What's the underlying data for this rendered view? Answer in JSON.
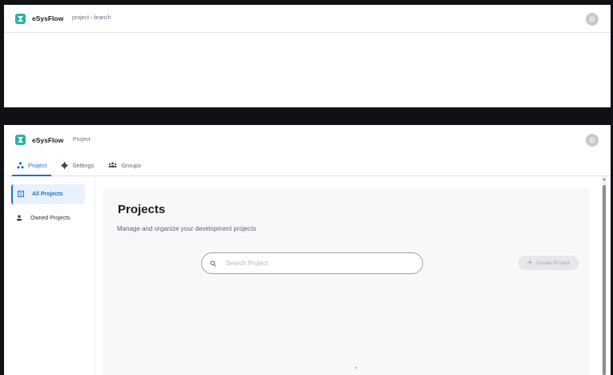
{
  "top_window": {
    "brand": "eSysFlow",
    "breadcrumb": "project › branch",
    "avatar_initial": "D"
  },
  "main_window": {
    "brand": "eSysFlow",
    "context_label": "Project",
    "avatar_initial": "D",
    "tabs": [
      {
        "label": "Project",
        "icon": "project-icon",
        "active": true
      },
      {
        "label": "Settings",
        "icon": "gear-icon",
        "active": false
      },
      {
        "label": "Groups",
        "icon": "groups-icon",
        "active": false
      }
    ],
    "sidebar": {
      "items": [
        {
          "label": "All Projects",
          "icon": "list-icon",
          "active": true
        },
        {
          "label": "Owned Projects",
          "icon": "user-icon",
          "active": false
        }
      ]
    },
    "content": {
      "title": "Projects",
      "subtitle": "Manage and organize your development projects",
      "search_placeholder": "Search Project",
      "create_button_label": "Create Project"
    }
  },
  "colors": {
    "accent": "#1f6fd6",
    "brand_logo": "#2bb1a6",
    "panel_bg": "#f7f8fa",
    "backdrop": "#0f1115"
  }
}
